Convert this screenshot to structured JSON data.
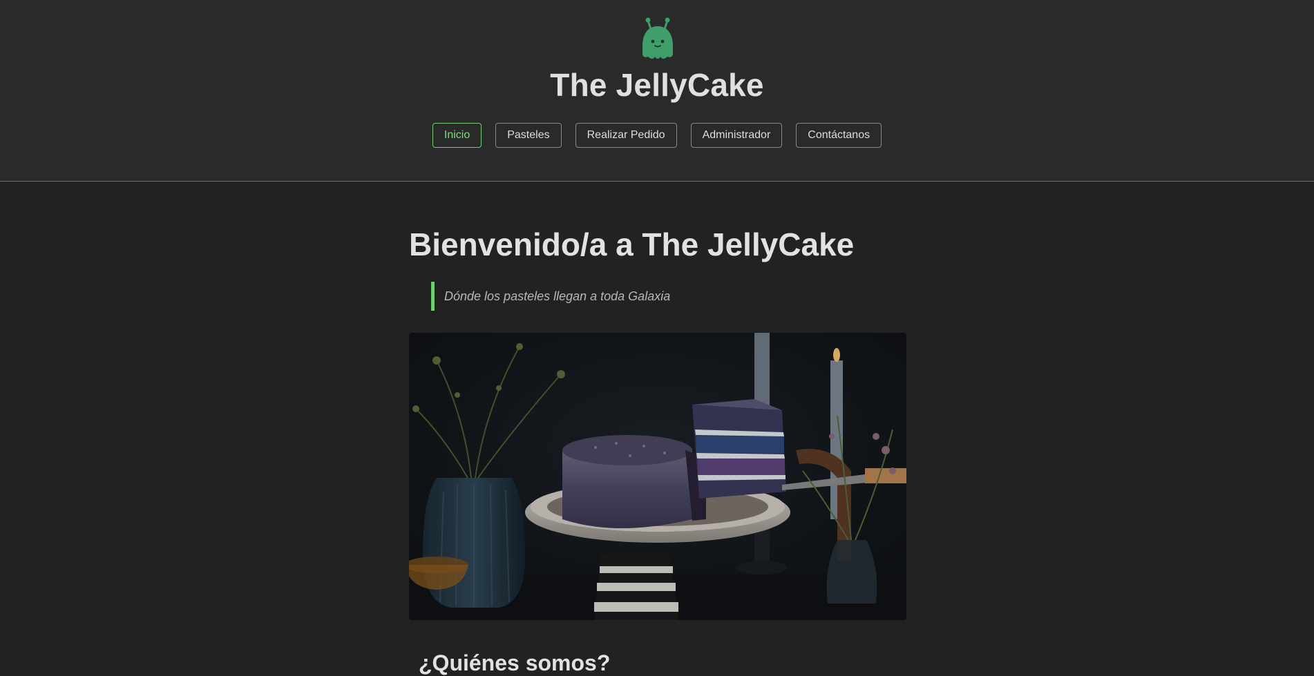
{
  "header": {
    "logo_icon": "jelly-alien-icon",
    "site_title": "The JellyCake",
    "accent_color": "#6fcf72"
  },
  "nav": {
    "items": [
      {
        "label": "Inicio",
        "active": true
      },
      {
        "label": "Pasteles",
        "active": false
      },
      {
        "label": "Realizar Pedido",
        "active": false
      },
      {
        "label": "Administrador",
        "active": false
      },
      {
        "label": "Contáctanos",
        "active": false
      }
    ]
  },
  "main": {
    "heading": "Bienvenido/a a The JellyCake",
    "tagline": "Dónde los pasteles llegan a toda Galaxia",
    "hero_image": "galaxy-cake-photo",
    "next_heading": "¿Quiénes somos?"
  }
}
